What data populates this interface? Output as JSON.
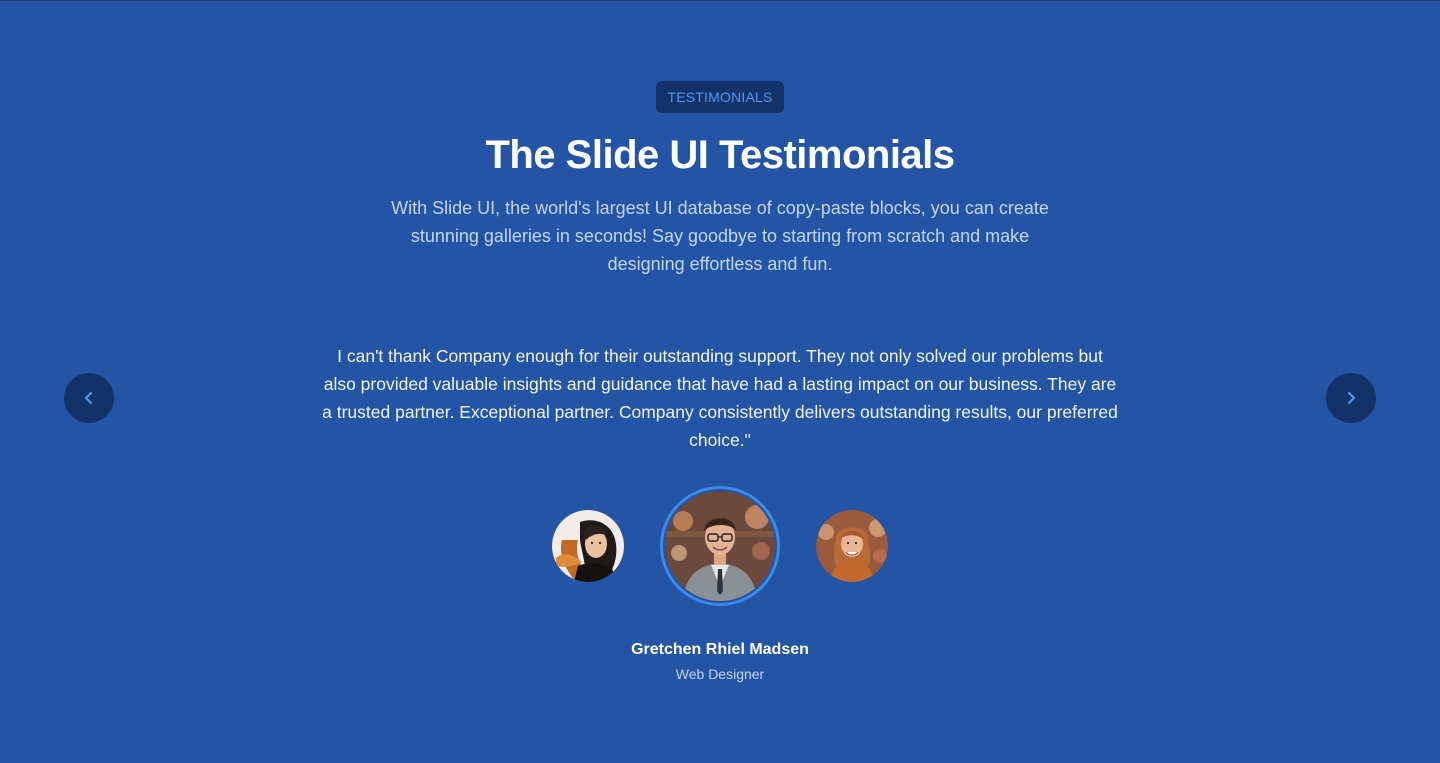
{
  "badge": "TESTIMONIALS",
  "title": "The Slide UI Testimonials",
  "subtitle": "With Slide UI, the world's largest UI database of copy-paste blocks, you can create stunning galleries in seconds! Say goodbye to starting from scratch and make designing effortless and fun.",
  "testimonial": {
    "quote": "I can't thank Company enough for their outstanding support. They not only solved our problems but also provided valuable insights and guidance that have had a lasting impact on our business. They are a trusted partner. Exceptional partner. Company consistently delivers outstanding results, our preferred choice.\"",
    "name": "Gretchen Rhiel Madsen",
    "role": "Web Designer"
  },
  "navigation": {
    "prev_icon": "chevron-left-icon",
    "next_icon": "chevron-right-icon"
  },
  "colors": {
    "background": "#2354a5",
    "badge_bg": "#14326a",
    "badge_text": "#4f9bf0",
    "accent_ring": "#3d8ae8"
  }
}
